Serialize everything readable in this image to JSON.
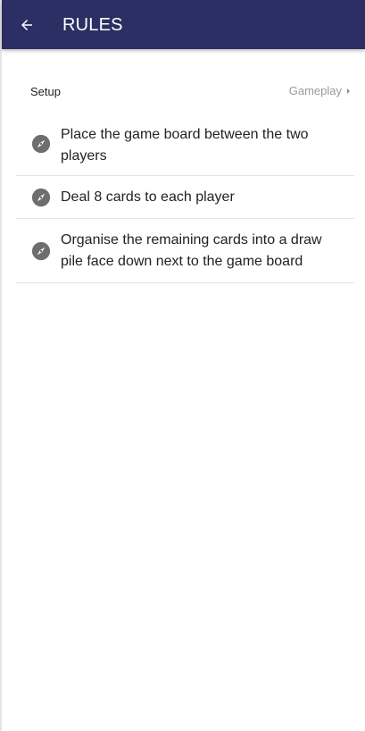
{
  "app_bar": {
    "title": "RULES",
    "back_icon": "arrow-left-icon",
    "background": "#2b2f63"
  },
  "tabs": {
    "current": "Setup",
    "next": "Gameplay",
    "next_icon": "caret-right-icon"
  },
  "rules": [
    {
      "text": "Place the game board between the two players",
      "icon": "compass-icon"
    },
    {
      "text": "Deal 8 cards to each player",
      "icon": "compass-icon"
    },
    {
      "text": "Organise the remaining cards into a draw pile face down next to the game board",
      "icon": "compass-icon"
    }
  ]
}
